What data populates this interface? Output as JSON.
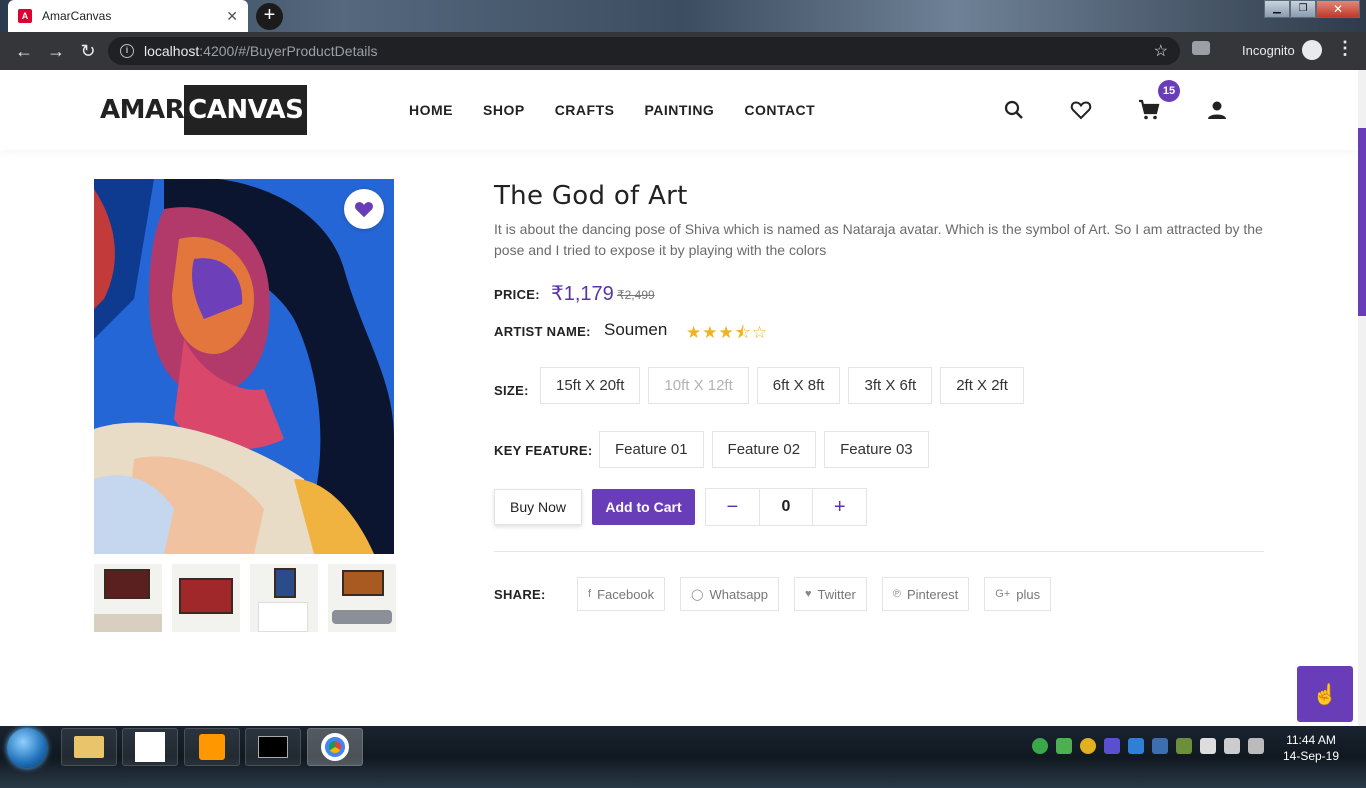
{
  "browser": {
    "tab_title": "AmarCanvas",
    "url_host": "localhost",
    "url_path": ":4200/#/BuyerProductDetails",
    "incognito_label": "Incognito"
  },
  "site": {
    "logo_part1": "AMAR",
    "logo_part2": "CANVAS",
    "nav": [
      "HOME",
      "SHOP",
      "CRAFTS",
      "PAINTING",
      "CONTACT"
    ],
    "cart_count": "15",
    "accent_color": "#6a3db8"
  },
  "product": {
    "title": "The God of Art",
    "description": "It is about the dancing pose of Shiva which is named as Nataraja avatar. Which is the symbol of Art. So I am attracted by the pose and I tried to expose it by playing with the colors",
    "price_label": "PRICE:",
    "price": "₹1,179",
    "old_price": "₹2,499",
    "artist_label": "ARTIST NAME:",
    "artist": "Soumen",
    "rating_stars": "★★★⯪☆",
    "rating": 3.5,
    "size_label": "SIZE:",
    "sizes": [
      "15ft X 20ft",
      "10ft X 12ft",
      "6ft X 8ft",
      "3ft X 6ft",
      "2ft X 2ft"
    ],
    "key_feature_label": "KEY FEATURE:",
    "features": [
      "Feature 01",
      "Feature 02",
      "Feature 03"
    ],
    "buy_now": "Buy Now",
    "add_to_cart": "Add to Cart",
    "qty_minus": "−",
    "quantity": "0",
    "qty_plus": "+",
    "share_label": "SHARE:",
    "share": [
      {
        "icon": "f",
        "label": "Facebook"
      },
      {
        "icon": "◯",
        "label": "Whatsapp"
      },
      {
        "icon": "♥",
        "label": "Twitter"
      },
      {
        "icon": "℗",
        "label": "Pinterest"
      },
      {
        "icon": "G+",
        "label": "plus"
      }
    ]
  },
  "taskbar": {
    "time": "11:44 AM",
    "date": "14-Sep-19"
  }
}
